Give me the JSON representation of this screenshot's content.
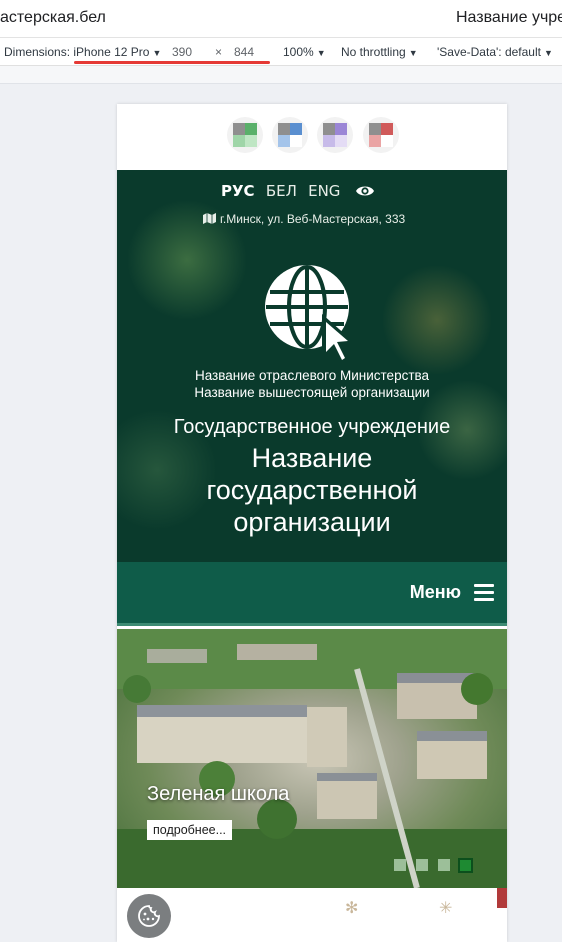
{
  "browser": {
    "url": "астерская.бел",
    "tab_title": "Название учре"
  },
  "devtools": {
    "dimensions_label": "Dimensions:",
    "device": "iPhone 12 Pro",
    "width": "390",
    "times": "×",
    "height": "844",
    "zoom": "100%",
    "throttling": "No throttling",
    "save_data": "'Save-Data': default"
  },
  "header": {
    "languages": [
      {
        "label": "РУС",
        "active": true
      },
      {
        "label": "БЕЛ",
        "active": false
      },
      {
        "label": "ENG",
        "active": false
      }
    ],
    "address": "г.Минск, ул. Веб-Мастерская, 333",
    "ministry_line1": "Название отраслевого Министерства",
    "ministry_line2": "Название вышестоящей организации",
    "org_type": "Государственное учреждение",
    "org_name": "Название государственной организации"
  },
  "menu": {
    "label": "Меню"
  },
  "slider": {
    "title": "Зеленая школа",
    "more_label": "подробнее...",
    "slide_count": 4,
    "active_slide": 4
  },
  "colors": {
    "header_bg": "#0a3a2c",
    "menu_bg": "#0f5c49",
    "accent_active_dot": "#1e8a32",
    "devtools_underline": "#e53935"
  },
  "icons": {
    "accessibility": [
      "contrast-green-icon",
      "contrast-blue-icon",
      "contrast-purple-icon",
      "contrast-red-icon"
    ],
    "eye": "eye-icon",
    "map": "map-icon",
    "logo": "globe-cursor-icon",
    "menu": "hamburger-icon",
    "cookie": "cookie-icon"
  }
}
